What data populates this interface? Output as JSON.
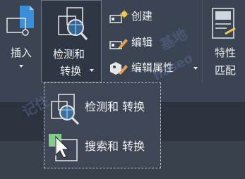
{
  "ribbon": {
    "insert": {
      "label": "插入"
    },
    "detect_convert": {
      "line1": "检测和",
      "line2": "转换"
    },
    "create": {
      "label": "创建"
    },
    "edit": {
      "label": "编辑"
    },
    "edit_attributes": {
      "label": "编辑属性"
    },
    "match_properties": {
      "line1": "特性",
      "line2": "匹配"
    }
  },
  "dropdown": {
    "items": [
      {
        "label": "检测和 转换"
      },
      {
        "label": "搜索和 转换"
      }
    ]
  },
  "watermark": {
    "text1": "记住",
    "text2": "基地",
    "text3": "haseo"
  },
  "colors": {
    "ribbon_bg": "#3b4453",
    "panel_band": "#2c333e",
    "accent_blue": "#3b8fd8",
    "green": "#7dcf8a"
  }
}
